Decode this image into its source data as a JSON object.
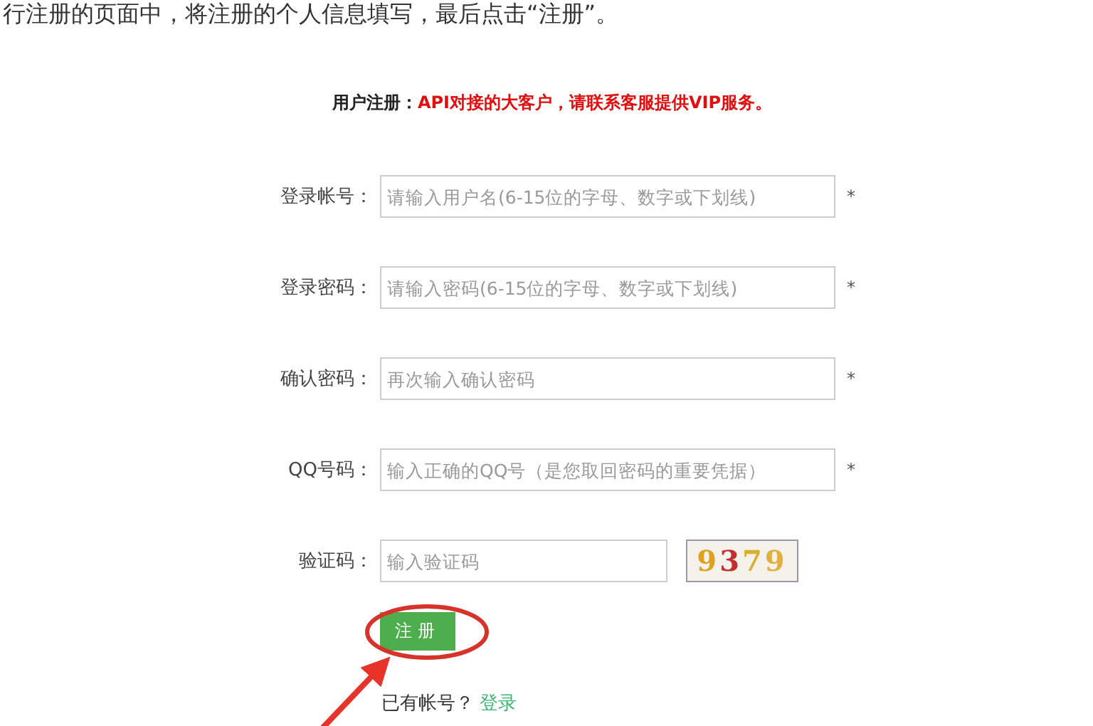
{
  "intro_text": "行注册的页面中，将注册的个人信息填写，最后点击“注册”。",
  "form": {
    "title": "用户注册：",
    "notice": "API对接的大客户，请联系客服提供VIP服务。",
    "fields": [
      {
        "kind": "text",
        "label": "登录帐号：",
        "placeholder": "请输入用户名(6-15位的字母、数字或下划线)",
        "required_mark": "*"
      },
      {
        "kind": "text",
        "label": "登录密码：",
        "placeholder": "请输入密码(6-15位的字母、数字或下划线)",
        "required_mark": "*"
      },
      {
        "kind": "text",
        "label": "确认密码：",
        "placeholder": "再次输入确认密码",
        "required_mark": "*"
      },
      {
        "kind": "text",
        "label": "QQ号码：",
        "placeholder": "输入正确的QQ号（是您取回密码的重要凭据）",
        "required_mark": "*"
      },
      {
        "kind": "captcha",
        "label": "验证码：",
        "placeholder": "输入验证码",
        "captcha": "9379"
      }
    ],
    "submit": "注册",
    "login_prompt": "已有帐号？",
    "login_link": "登录"
  }
}
